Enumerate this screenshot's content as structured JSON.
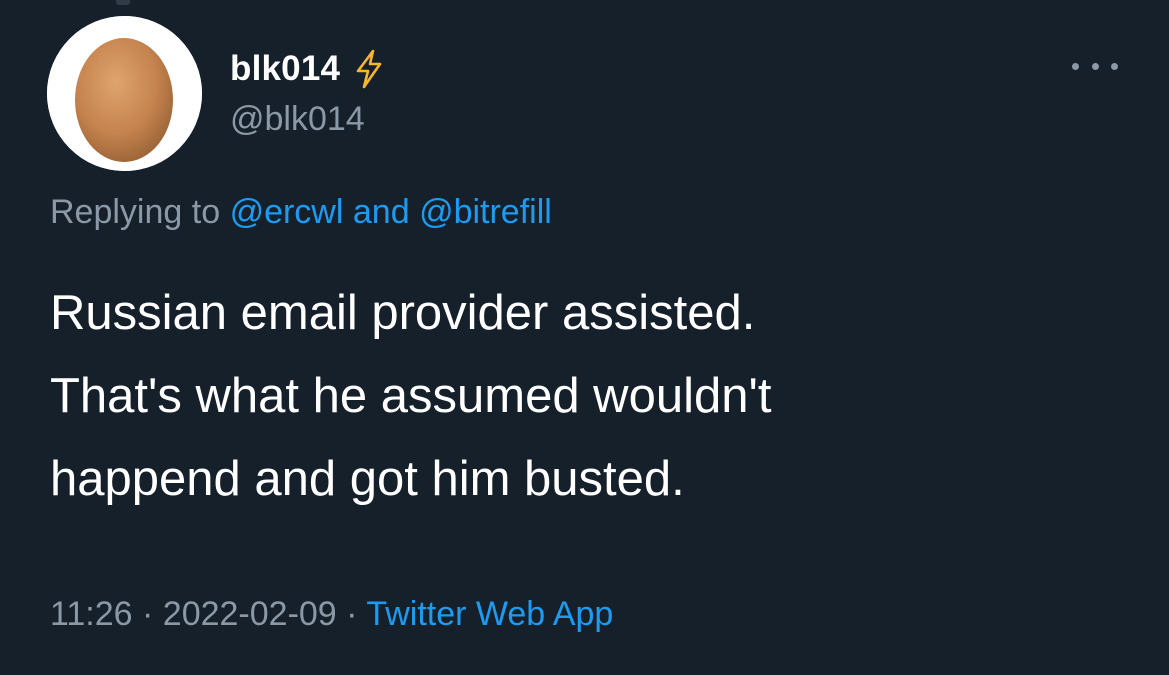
{
  "colors": {
    "background": "#15202b",
    "text_primary": "#ffffff",
    "text_secondary": "#8b98a5",
    "link": "#1d9bf0",
    "bolt": "#f7b52c"
  },
  "tweet": {
    "author": {
      "display_name": "blk014",
      "badge_icon": "lightning-bolt-icon",
      "handle": "@blk014",
      "avatar_icon": "egg-avatar"
    },
    "more_icon": "more-options-icon",
    "reply_context": {
      "prefix": "Replying to",
      "mention_1": "@ercwl",
      "separator": "and",
      "mention_2": "@bitrefill"
    },
    "text_lines": [
      "Russian email provider assisted.",
      "That's what he assumed wouldn't",
      "happend and got him busted."
    ],
    "meta": {
      "time": "11:26",
      "separator": "·",
      "date": "2022-02-09",
      "source": "Twitter Web App"
    }
  }
}
